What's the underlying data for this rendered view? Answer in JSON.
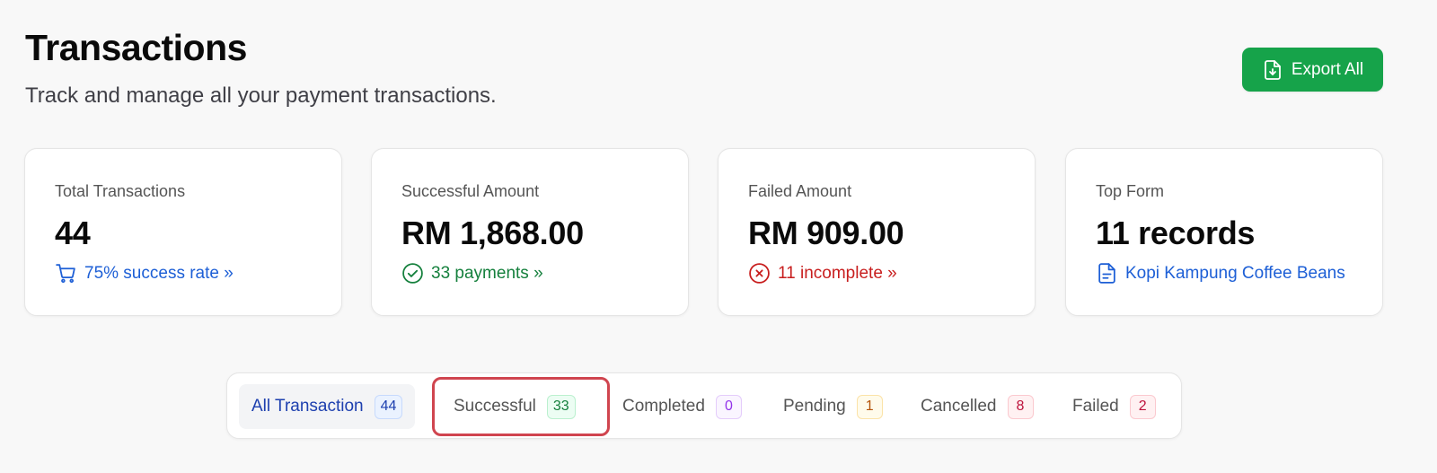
{
  "header": {
    "title": "Transactions",
    "subtitle": "Track and manage all your payment transactions.",
    "export_label": "Export All"
  },
  "cards": [
    {
      "label": "Total Transactions",
      "value": "44",
      "link": "75% success rate »",
      "icon": "cart-icon",
      "color": "#1d5fd6"
    },
    {
      "label": "Successful Amount",
      "value": "RM 1,868.00",
      "link": "33 payments »",
      "icon": "check-circle-icon",
      "color": "#15803d"
    },
    {
      "label": "Failed Amount",
      "value": "RM 909.00",
      "link": "11 incomplete »",
      "icon": "x-circle-icon",
      "color": "#c81e1e"
    },
    {
      "label": "Top Form",
      "value": "11 records",
      "link": "Kopi Kampung Coffee Beans",
      "icon": "document-icon",
      "color": "#1d5fd6"
    }
  ],
  "tabs": [
    {
      "label": "All Transaction",
      "count": "44",
      "active": true
    },
    {
      "label": "Successful",
      "count": "33",
      "highlighted": true
    },
    {
      "label": "Completed",
      "count": "0"
    },
    {
      "label": "Pending",
      "count": "1"
    },
    {
      "label": "Cancelled",
      "count": "8"
    },
    {
      "label": "Failed",
      "count": "2"
    }
  ],
  "colors": {
    "accent_green": "#16a34a",
    "highlight_red": "#d0454f"
  }
}
